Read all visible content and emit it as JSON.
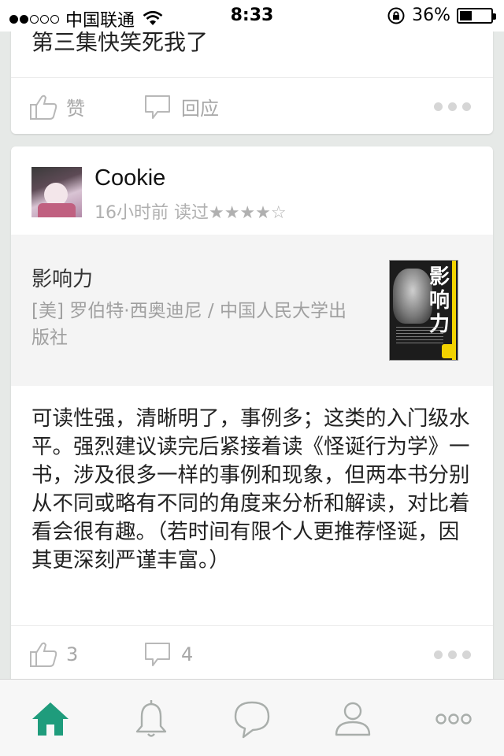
{
  "status_bar": {
    "signal_filled": 2,
    "signal_total": 5,
    "carrier": "中国联通",
    "time": "8:33",
    "battery": "36%",
    "battery_level": 0.36
  },
  "previous_card": {
    "comment": "第三集快笑死我了",
    "actions": {
      "like_label": "赞",
      "reply_label": "回应"
    }
  },
  "post": {
    "username": "Cookie",
    "meta": "16小时前 读过★★★★☆",
    "rating": 4,
    "book": {
      "title": "影响力",
      "author": "[美] 罗伯特·西奥迪尼 / 中国人民大学出版社",
      "cover_text": "影响力"
    },
    "review": "可读性强，清晰明了，事例多；这类的入门级水平。强烈建议读完后紧接着读《怪诞行为学》一书，涉及很多一样的事例和现象，但两本书分别从不同或略有不同的角度来分析和解读，对比着看会很有趣。（若时间有限个人更推荐怪诞，因其更深刻严谨丰富。）",
    "likes": "3",
    "replies": "4"
  },
  "tab_bar": {
    "tabs": [
      {
        "name": "home",
        "icon": "home-icon",
        "active": true
      },
      {
        "name": "notifications",
        "icon": "bell-icon",
        "active": false
      },
      {
        "name": "messages",
        "icon": "chat-icon",
        "active": false
      },
      {
        "name": "profile",
        "icon": "person-icon",
        "active": false
      },
      {
        "name": "more",
        "icon": "more-icon",
        "active": false
      }
    ]
  },
  "colors": {
    "accent": "#1f9c7c",
    "inactive_icon": "#a9aeab",
    "muted_text": "#a8a8a8"
  }
}
